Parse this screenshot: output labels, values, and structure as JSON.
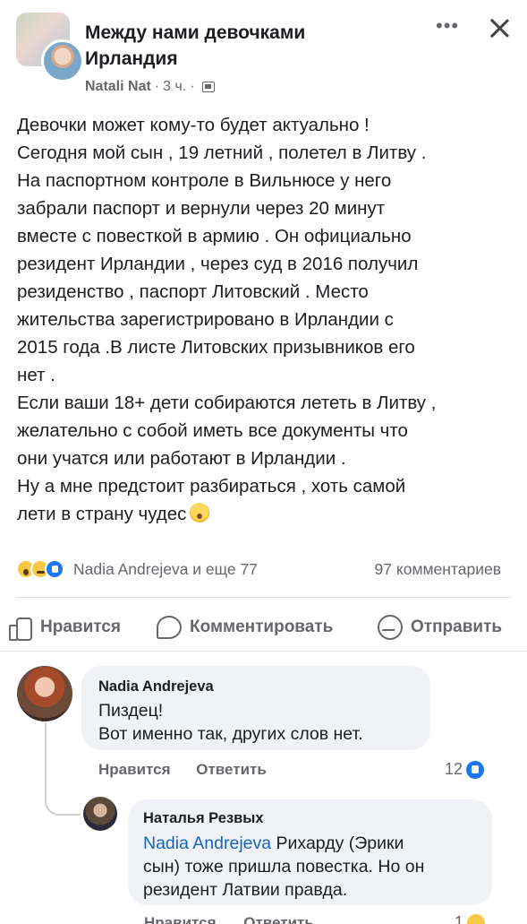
{
  "post": {
    "group_name_line1": "Между нами девочками",
    "group_name_line2": "Ирландия",
    "author": "Natali Nat",
    "time": "3 ч.",
    "separator": "·",
    "body_lines": [
      "Девочки может кому-то будет актуально !",
      "Сегодня мой сын , 19 летний , полетел в Литву .",
      "На паспортном контроле в Вильнюсе у него",
      "забрали паспорт и вернули через 20 минут",
      "вместе с повесткой в армию . Он официально",
      "резидент Ирландии , через суд в 2016 получил",
      "резиденство , паспорт Литовский . Место",
      "жительства зарегистрировано в Ирландии с",
      "2015 года .В листе Литовских призывников его",
      "нет .",
      "Если ваши 18+ дети собираются лететь в Литву ,",
      "желательно с собой иметь все документы что",
      "они учатся или работают в Ирландии .",
      "Ну а мне предстоит разбираться , хоть самой",
      "лети в страну чудес"
    ],
    "reactions_text": "Nadia Andrejeva и еще 77",
    "comments_count": "97 комментариев"
  },
  "actions": {
    "like": "Нравится",
    "comment": "Комментировать",
    "send": "Отправить"
  },
  "comments": [
    {
      "name": "Nadia Andrejeva",
      "lines": [
        "Пиздец!",
        "Вот именно так, других слов нет."
      ],
      "like_label": "Нравится",
      "reply_label": "Ответить",
      "reaction_count": "12"
    },
    {
      "name": "Наталья Резвых",
      "mention": "Nadia Andrejeva",
      "line1_rest": " Рихарду (Эрики",
      "line2": "сын) тоже пришла повестка. Но он",
      "line3": "резидент Латвии правда.",
      "like_label": "Нравится",
      "reply_label": "Ответить",
      "reaction_count": "1"
    }
  ]
}
